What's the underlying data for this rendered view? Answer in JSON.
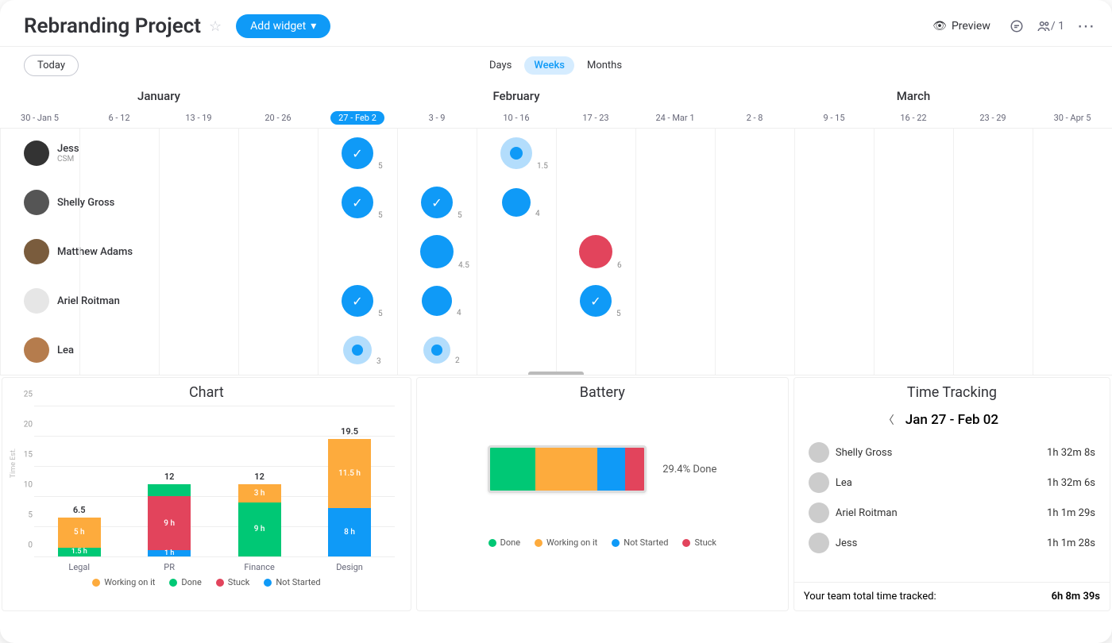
{
  "header": {
    "title": "Rebranding Project",
    "add_widget": "Add widget",
    "preview": "Preview",
    "member_count": "/ 1"
  },
  "timeline": {
    "today": "Today",
    "scales": [
      "Days",
      "Weeks",
      "Months"
    ],
    "active_scale": 1,
    "months": [
      "January",
      "February",
      "March"
    ],
    "weeks": [
      "30 - Jan 5",
      "6 - 12",
      "13 - 19",
      "20 - 26",
      "27 - Feb 2",
      "3 - 9",
      "10 - 16",
      "17 - 23",
      "24 - Mar 1",
      "2 - 8",
      "9 - 15",
      "16 - 22",
      "23 - 29",
      "30 - Apr 5"
    ],
    "selected_week_index": 4,
    "people": [
      {
        "name": "Jess",
        "subtitle": "CSM"
      },
      {
        "name": "Shelly Gross",
        "subtitle": ""
      },
      {
        "name": "Matthew Adams",
        "subtitle": ""
      },
      {
        "name": "Ariel Roitman",
        "subtitle": ""
      },
      {
        "name": "Lea",
        "subtitle": ""
      }
    ],
    "bubbles": [
      {
        "row": 0,
        "col": 4,
        "size": 40,
        "variant": "check",
        "num": "5"
      },
      {
        "row": 0,
        "col": 6,
        "size": 40,
        "variant": "ring",
        "num": "1.5"
      },
      {
        "row": 1,
        "col": 4,
        "size": 40,
        "variant": "check",
        "num": "5"
      },
      {
        "row": 1,
        "col": 5,
        "size": 40,
        "variant": "check",
        "num": "5"
      },
      {
        "row": 1,
        "col": 6,
        "size": 36,
        "variant": "solid",
        "num": "4"
      },
      {
        "row": 2,
        "col": 5,
        "size": 42,
        "variant": "solid",
        "num": "4.5"
      },
      {
        "row": 2,
        "col": 7,
        "size": 42,
        "variant": "red",
        "num": "6"
      },
      {
        "row": 3,
        "col": 4,
        "size": 40,
        "variant": "check",
        "num": "5"
      },
      {
        "row": 3,
        "col": 5,
        "size": 38,
        "variant": "solid",
        "num": "4"
      },
      {
        "row": 3,
        "col": 7,
        "size": 40,
        "variant": "check",
        "num": "5"
      },
      {
        "row": 4,
        "col": 4,
        "size": 36,
        "variant": "ring",
        "num": "3"
      },
      {
        "row": 4,
        "col": 5,
        "size": 34,
        "variant": "ring",
        "num": "2"
      }
    ]
  },
  "chart": {
    "title": "Chart",
    "ylabel": "Time Est.",
    "ymax": 25,
    "yticks": [
      0,
      5,
      10,
      15,
      20,
      25
    ],
    "categories": [
      "Legal",
      "PR",
      "Finance",
      "Design"
    ],
    "legend": [
      {
        "key": "work",
        "label": "Working on it",
        "color": "#fdab3d"
      },
      {
        "key": "done",
        "label": "Done",
        "color": "#00c875"
      },
      {
        "key": "stuck",
        "label": "Stuck",
        "color": "#e2445c"
      },
      {
        "key": "ns",
        "label": "Not Started",
        "color": "#0f9af7"
      }
    ],
    "totals": [
      "6.5",
      "12",
      "12",
      "19.5"
    ],
    "stacks": [
      [
        {
          "key": "done",
          "val": 1.5,
          "label": "1.5 h"
        },
        {
          "key": "work",
          "val": 5,
          "label": "5 h"
        }
      ],
      [
        {
          "key": "ns",
          "val": 1,
          "label": "1 h"
        },
        {
          "key": "stuck",
          "val": 9,
          "label": "9 h"
        },
        {
          "key": "done",
          "val": 2,
          "label": ""
        }
      ],
      [
        {
          "key": "done",
          "val": 9,
          "label": "9 h"
        },
        {
          "key": "work",
          "val": 3,
          "label": "3 h"
        }
      ],
      [
        {
          "key": "ns",
          "val": 8,
          "label": "8 h"
        },
        {
          "key": "work",
          "val": 11.5,
          "label": "11.5 h"
        }
      ]
    ]
  },
  "battery": {
    "title": "Battery",
    "pct_label": "29.4% Done",
    "legend": [
      {
        "key": "done",
        "label": "Done",
        "color": "#00c875",
        "pct": 29.4
      },
      {
        "key": "work",
        "label": "Working on it",
        "color": "#fdab3d",
        "pct": 40
      },
      {
        "key": "ns",
        "label": "Not Started",
        "color": "#0f9af7",
        "pct": 18
      },
      {
        "key": "stuck",
        "label": "Stuck",
        "color": "#e2445c",
        "pct": 12.6
      }
    ]
  },
  "tracking": {
    "title": "Time Tracking",
    "range": "Jan 27 - Feb 02",
    "rows": [
      {
        "name": "Shelly Gross",
        "time": "1h 32m 8s"
      },
      {
        "name": "Lea",
        "time": "1h 32m 6s"
      },
      {
        "name": "Ariel Roitman",
        "time": "1h 1m 29s"
      },
      {
        "name": "Jess",
        "time": "1h 1m 28s"
      }
    ],
    "total_label": "Your team total time tracked:",
    "total_time": "6h 8m 39s"
  },
  "chart_data": [
    {
      "type": "bar",
      "title": "Chart",
      "ylabel": "Time Est.",
      "ylim": [
        0,
        25
      ],
      "categories": [
        "Legal",
        "PR",
        "Finance",
        "Design"
      ],
      "series": [
        {
          "name": "Working on it",
          "values": [
            5,
            0,
            3,
            11.5
          ]
        },
        {
          "name": "Done",
          "values": [
            1.5,
            2,
            9,
            0
          ]
        },
        {
          "name": "Stuck",
          "values": [
            0,
            9,
            0,
            0
          ]
        },
        {
          "name": "Not Started",
          "values": [
            0,
            1,
            0,
            8
          ]
        }
      ],
      "totals": [
        6.5,
        12,
        12,
        19.5
      ]
    },
    {
      "type": "bar",
      "title": "Battery",
      "categories": [
        "Done",
        "Working on it",
        "Not Started",
        "Stuck"
      ],
      "values": [
        29.4,
        40,
        18,
        12.6
      ],
      "annotation": "29.4% Done"
    }
  ]
}
